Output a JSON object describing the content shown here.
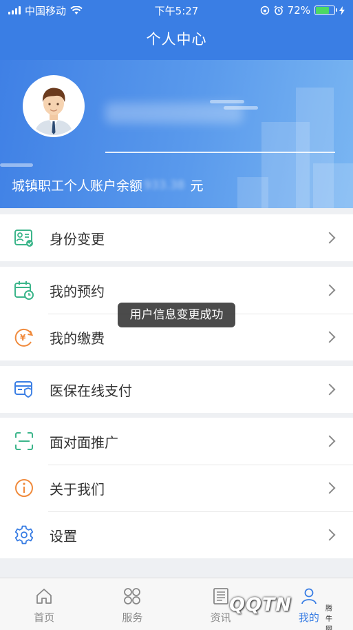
{
  "status": {
    "carrier": "中国移动",
    "time": "下午5:27",
    "battery": "72%",
    "battery_level": 0.72
  },
  "header": {
    "title": "个人中心"
  },
  "profile": {
    "balance_label": "城镇职工个人账户余额",
    "balance_value": "933.38",
    "balance_unit": "元"
  },
  "menu": {
    "groups": [
      [
        {
          "label": "身份变更",
          "icon": "id-card-icon"
        }
      ],
      [
        {
          "label": "我的预约",
          "icon": "calendar-clock-icon"
        },
        {
          "label": "我的缴费",
          "icon": "yuan-coin-icon"
        }
      ],
      [
        {
          "label": "医保在线支付",
          "icon": "card-shield-icon"
        }
      ],
      [
        {
          "label": "面对面推广",
          "icon": "scan-icon"
        },
        {
          "label": "关于我们",
          "icon": "info-icon"
        },
        {
          "label": "设置",
          "icon": "gear-icon"
        }
      ]
    ]
  },
  "toast": {
    "text": "用户信息变更成功"
  },
  "tabbar": {
    "items": [
      {
        "label": "首页",
        "icon": "home-icon"
      },
      {
        "label": "服务",
        "icon": "grid-icon"
      },
      {
        "label": "资讯",
        "icon": "news-icon"
      },
      {
        "label": "我的",
        "icon": "user-icon"
      }
    ],
    "active": 3
  },
  "colors": {
    "primary": "#3a7ee4",
    "green_icon": "#3bb58a",
    "orange_icon": "#f08a3c",
    "blue_icon": "#3a7ee4"
  },
  "watermark": {
    "text": "QQTN",
    "sub": "腾牛网"
  }
}
